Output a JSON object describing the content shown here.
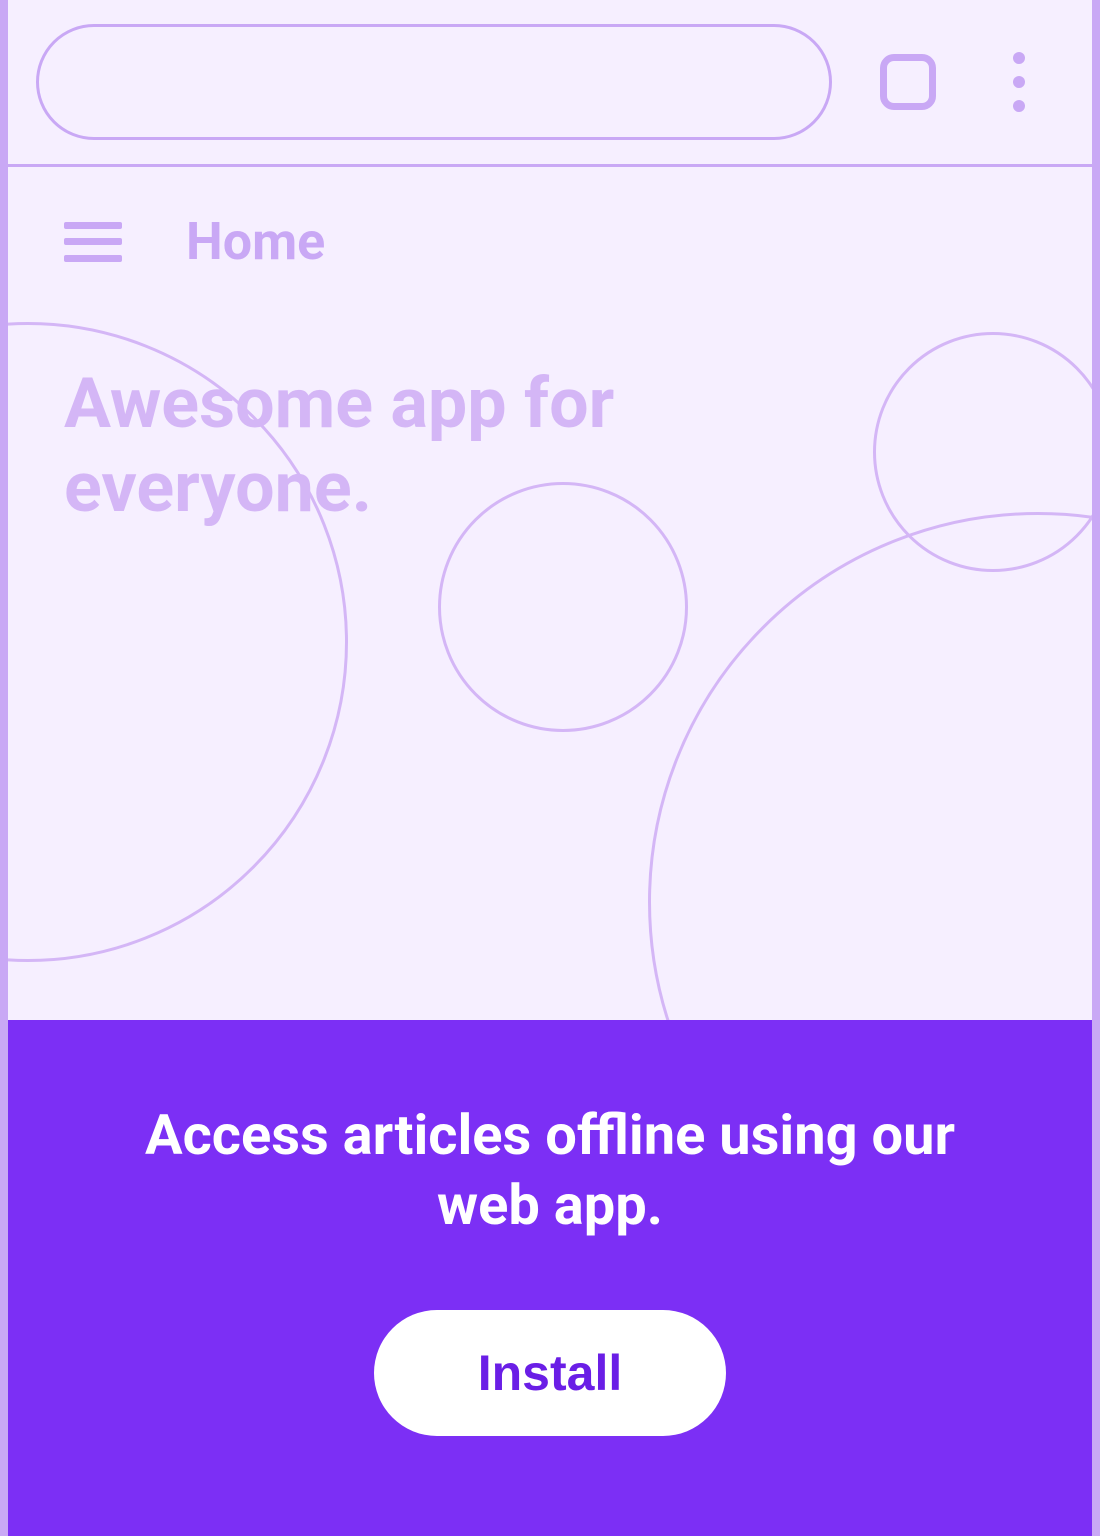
{
  "browser": {
    "url_value": "",
    "tab_icon": "tab-square-icon",
    "overflow_icon": "kebab-icon"
  },
  "appbar": {
    "menu_icon": "hamburger-icon",
    "title": "Home"
  },
  "hero": {
    "headline": "Awesome app for everyone."
  },
  "banner": {
    "message": "Access articles offline using our web app.",
    "install_label": "Install"
  },
  "colors": {
    "accent_light": "#c9a8f5",
    "accent_lighter": "#d4b6f6",
    "banner_bg": "#7c2ff5",
    "page_bg": "#f6efff"
  }
}
